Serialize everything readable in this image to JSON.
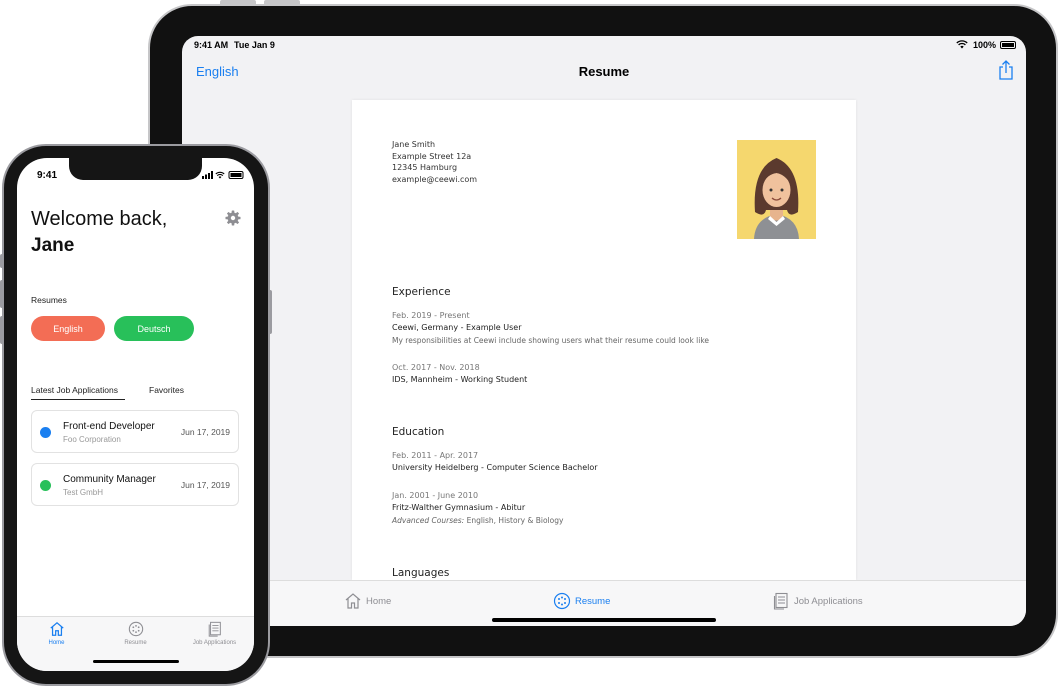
{
  "ipad": {
    "status": {
      "time": "9:41 AM",
      "date": "Tue Jan 9",
      "battery": "100%"
    },
    "nav": {
      "language": "English",
      "title": "Resume"
    },
    "resume": {
      "name": "Jane Smith",
      "street": "Example Street 12a",
      "city": "12345 Hamburg",
      "email": "example@ceewi.com",
      "experience_title": "Experience",
      "experience": [
        {
          "dates": "Feb. 2019 - Present",
          "position": "Ceewi, Germany - Example User",
          "description": "My responsibilities at Ceewi include showing users what their resume could look like"
        },
        {
          "dates": "Oct. 2017 - Nov. 2018",
          "position": "IDS, Mannheim - Working Student"
        }
      ],
      "education_title": "Education",
      "education": [
        {
          "dates": "Feb. 2011 - Apr. 2017",
          "position": "University Heidelberg - Computer Science Bachelor"
        },
        {
          "dates": "Jan. 2001 - June 2010",
          "position": "Fritz-Walther Gymnasium - Abitur",
          "courses_label": "Advanced Courses:",
          "courses": "English, History & Biology"
        }
      ],
      "languages_title": "Languages"
    },
    "tabs": [
      {
        "label": "Home",
        "icon": "house-icon"
      },
      {
        "label": "Resume",
        "icon": "resume-icon",
        "active": true
      },
      {
        "label": "Job Applications",
        "icon": "document-icon"
      }
    ]
  },
  "iphone": {
    "status": {
      "time": "9:41"
    },
    "welcome": "Welcome back,",
    "name": "Jane",
    "resumes_label": "Resumes",
    "resume_buttons": [
      {
        "label": "English",
        "color": "#f36d55"
      },
      {
        "label": "Deutsch",
        "color": "#28c05a"
      }
    ],
    "list_tabs": [
      "Latest Job Applications",
      "Favorites"
    ],
    "applications": [
      {
        "title": "Front-end Developer",
        "company": "Foo Corporation",
        "date": "Jun 17, 2019",
        "color": "#1a7ff0"
      },
      {
        "title": "Community Manager",
        "company": "Test GmbH",
        "date": "Jun 17, 2019",
        "color": "#28c05a"
      }
    ],
    "tabs": [
      {
        "label": "Home",
        "icon": "house-icon",
        "active": true
      },
      {
        "label": "Resume",
        "icon": "resume-icon"
      },
      {
        "label": "Job Applications",
        "icon": "document-icon"
      }
    ]
  },
  "colors": {
    "accent": "#1a7ff0",
    "english": "#f36d55",
    "deutsch": "#28c05a"
  }
}
